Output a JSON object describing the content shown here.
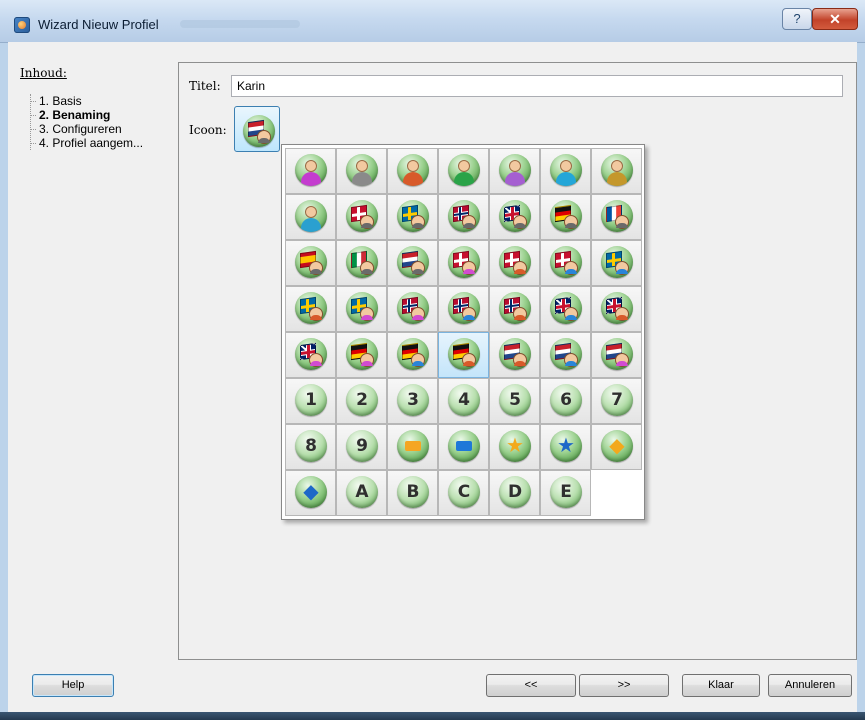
{
  "window": {
    "title": "Wizard Nieuw Profiel",
    "help_glyph": "?",
    "close_glyph": "✕"
  },
  "sidebar": {
    "heading": "Inhoud:",
    "steps": [
      "1. Basis",
      "2. Benaming",
      "3. Configureren",
      "4. Profiel aangem..."
    ],
    "active_step": 1
  },
  "form": {
    "title_label": "Titel:",
    "title_value": "Karin",
    "icon_label": "Icoon:",
    "selected_icon": "flag-netherlands-gray"
  },
  "icon_grid": {
    "selected": 31,
    "icons": [
      {
        "kind": "person",
        "shirt": "#c43ccf"
      },
      {
        "kind": "person",
        "shirt": "#8a8a8a"
      },
      {
        "kind": "person",
        "shirt": "#d85a2a"
      },
      {
        "kind": "person",
        "shirt": "#2aa348"
      },
      {
        "kind": "person",
        "shirt": "#a55fd1"
      },
      {
        "kind": "person",
        "shirt": "#23a6d8"
      },
      {
        "kind": "person",
        "shirt": "#c4972b"
      },
      {
        "kind": "person",
        "shirt": "#2aa0d0"
      },
      {
        "kind": "flag",
        "flag": "denmark",
        "shirt": "#6a6a6a"
      },
      {
        "kind": "flag",
        "flag": "sweden",
        "shirt": "#6a6a6a"
      },
      {
        "kind": "flag",
        "flag": "norway",
        "shirt": "#6a6a6a"
      },
      {
        "kind": "flag",
        "flag": "uk",
        "shirt": "#6a6a6a"
      },
      {
        "kind": "flag",
        "flag": "germany",
        "shirt": "#6a6a6a"
      },
      {
        "kind": "flag",
        "flag": "france",
        "shirt": "#6a6a6a"
      },
      {
        "kind": "flag",
        "flag": "spain",
        "shirt": "#6a6a6a"
      },
      {
        "kind": "flag",
        "flag": "italy",
        "shirt": "#6a6a6a"
      },
      {
        "kind": "flag",
        "flag": "netherlands",
        "shirt": "#6a6a6a"
      },
      {
        "kind": "flag",
        "flag": "denmark",
        "shirt": "#d24bd1"
      },
      {
        "kind": "flag",
        "flag": "denmark",
        "shirt": "#d85a2a"
      },
      {
        "kind": "flag",
        "flag": "denmark",
        "shirt": "#2a84d8"
      },
      {
        "kind": "flag",
        "flag": "sweden",
        "shirt": "#2a84d8"
      },
      {
        "kind": "flag",
        "flag": "sweden",
        "shirt": "#d85a2a"
      },
      {
        "kind": "flag",
        "flag": "sweden",
        "shirt": "#d24bd1"
      },
      {
        "kind": "flag",
        "flag": "norway",
        "shirt": "#d24bd1"
      },
      {
        "kind": "flag",
        "flag": "norway",
        "shirt": "#2a84d8"
      },
      {
        "kind": "flag",
        "flag": "norway",
        "shirt": "#d85a2a"
      },
      {
        "kind": "flag",
        "flag": "uk",
        "shirt": "#2a84d8"
      },
      {
        "kind": "flag",
        "flag": "uk",
        "shirt": "#d85a2a"
      },
      {
        "kind": "flag",
        "flag": "uk",
        "shirt": "#d24bd1"
      },
      {
        "kind": "flag",
        "flag": "germany",
        "shirt": "#d24bd1"
      },
      {
        "kind": "flag",
        "flag": "germany",
        "shirt": "#2a84d8"
      },
      {
        "kind": "flag",
        "flag": "germany",
        "shirt": "#d85a2a"
      },
      {
        "kind": "flag",
        "flag": "netherlands",
        "shirt": "#d85a2a"
      },
      {
        "kind": "flag",
        "flag": "netherlands",
        "shirt": "#2a84d8"
      },
      {
        "kind": "flag",
        "flag": "netherlands",
        "shirt": "#d24bd1"
      },
      {
        "kind": "glyph",
        "text": "1"
      },
      {
        "kind": "glyph",
        "text": "2"
      },
      {
        "kind": "glyph",
        "text": "3"
      },
      {
        "kind": "glyph",
        "text": "4"
      },
      {
        "kind": "glyph",
        "text": "5"
      },
      {
        "kind": "glyph",
        "text": "6"
      },
      {
        "kind": "glyph",
        "text": "7"
      },
      {
        "kind": "glyph",
        "text": "8"
      },
      {
        "kind": "glyph",
        "text": "9"
      },
      {
        "kind": "rect",
        "color": "#f5a623"
      },
      {
        "kind": "rect",
        "color": "#1e78d8"
      },
      {
        "kind": "sym",
        "text": "★",
        "color": "#f3a91c"
      },
      {
        "kind": "sym",
        "text": "★",
        "color": "#1e68c8"
      },
      {
        "kind": "sym",
        "text": "◆",
        "color": "#f3a91c"
      },
      {
        "kind": "sym",
        "text": "◆",
        "color": "#1e68c8"
      },
      {
        "kind": "glyph",
        "text": "A"
      },
      {
        "kind": "glyph",
        "text": "B"
      },
      {
        "kind": "glyph",
        "text": "C"
      },
      {
        "kind": "glyph",
        "text": "D"
      },
      {
        "kind": "glyph",
        "text": "E"
      }
    ]
  },
  "footer": {
    "help": "Help",
    "back": "<<",
    "next": ">>",
    "finish": "Klaar",
    "cancel": "Annuleren"
  }
}
